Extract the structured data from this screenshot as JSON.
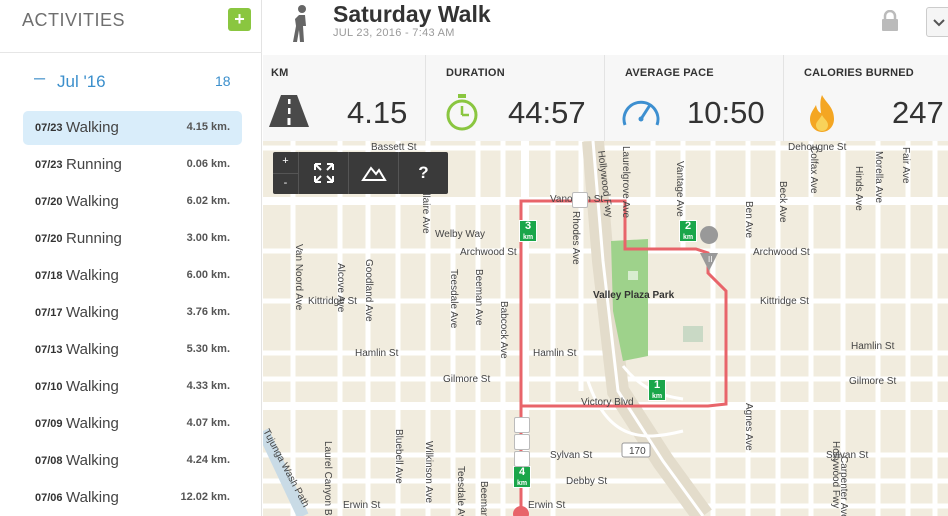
{
  "sidebar": {
    "title": "ACTIVITIES",
    "add_label": "+",
    "month": {
      "label": "Jul '16",
      "count": "18",
      "collapse": "–"
    },
    "activities": [
      {
        "date": "07/23",
        "type": "Walking",
        "km": "4.15 km."
      },
      {
        "date": "07/23",
        "type": "Running",
        "km": "0.06 km."
      },
      {
        "date": "07/20",
        "type": "Walking",
        "km": "6.02 km."
      },
      {
        "date": "07/20",
        "type": "Running",
        "km": "3.00 km."
      },
      {
        "date": "07/18",
        "type": "Walking",
        "km": "6.00 km."
      },
      {
        "date": "07/17",
        "type": "Walking",
        "km": "3.76 km."
      },
      {
        "date": "07/13",
        "type": "Walking",
        "km": "5.30 km."
      },
      {
        "date": "07/10",
        "type": "Walking",
        "km": "4.33 km."
      },
      {
        "date": "07/09",
        "type": "Walking",
        "km": "4.07 km."
      },
      {
        "date": "07/08",
        "type": "Walking",
        "km": "4.24 km."
      },
      {
        "date": "07/06",
        "type": "Walking",
        "km": "12.02 km."
      }
    ]
  },
  "header": {
    "title": "Saturday Walk",
    "date": "JUL 23, 2016  -  7:43 AM"
  },
  "stats": [
    {
      "label": "KM",
      "value": "4.15",
      "icon": "road-icon"
    },
    {
      "label": "DURATION",
      "value": "44:57",
      "icon": "stopwatch-icon"
    },
    {
      "label": "AVERAGE PACE",
      "value": "10:50",
      "icon": "speedometer-icon"
    },
    {
      "label": "CALORIES BURNED",
      "value": "247",
      "icon": "flame-icon"
    }
  ],
  "map": {
    "controls": {
      "zoom_in": "+",
      "zoom_out": "-",
      "help": "?"
    },
    "streets": [
      "Bassett St",
      "Dehougne St",
      "Vanowen St",
      "Archwood St",
      "Kittridge St",
      "Hamlin St",
      "Gilmore St",
      "Victory Blvd",
      "Sylvan St",
      "Debby St",
      "Erwin St",
      "Welby Way",
      "Hollywood Fwy",
      "Laurelgrove Ave",
      "Vantage Ave",
      "Rhodes Ave",
      "Babcock Ave",
      "Beeman Ave",
      "Teesdale Ave",
      "Goodland Ave",
      "Alcove Ave",
      "Van Noord Ave",
      "Bellaire Ave",
      "Ben Ave",
      "Agnes Ave",
      "Morella Ave",
      "Hinds Ave",
      "Carpenter Ave",
      "Bluebell Ave",
      "Wilkinson Ave",
      "Beck Ave",
      "Colfax Ave",
      "Fair Ave",
      "170",
      "Tujunga Wash Path",
      "Laurel Canyon Blvd"
    ],
    "park": "Valley Plaza Park",
    "km_markers": [
      "1",
      "2",
      "3",
      "4"
    ],
    "km_unit": "km",
    "route_color": "#e8646a"
  }
}
